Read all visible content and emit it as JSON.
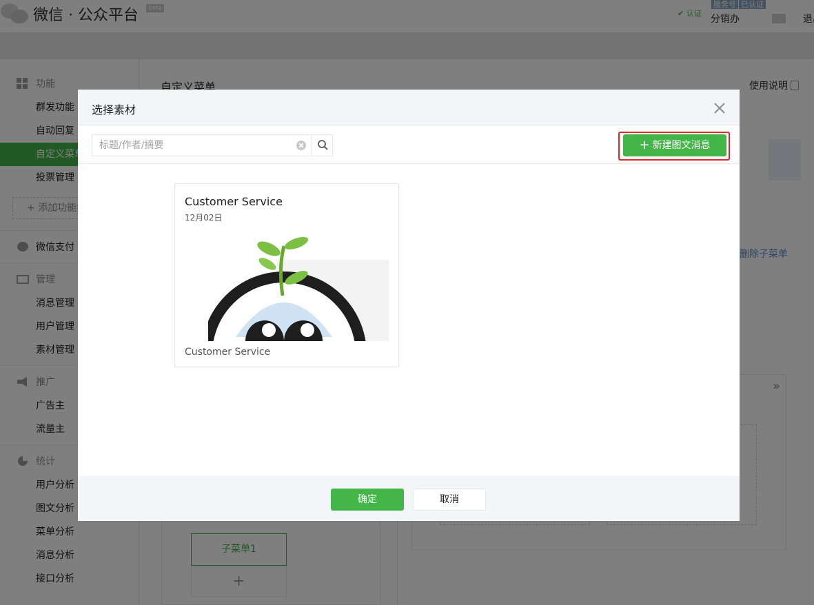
{
  "header": {
    "brand": "微信 · 公众平台",
    "beta_badge": "beta",
    "verified_badge": "✔ 认证",
    "account_type_tag": "服务号",
    "certified_tag": "已认证",
    "account_name": "分销办",
    "logout": "退出"
  },
  "sidebar": {
    "groups": [
      {
        "label": "功能",
        "icon": "grid-icon",
        "items": [
          "群发功能",
          "自动回复",
          "自定义菜单",
          "投票管理"
        ]
      },
      {
        "label": "微信支付",
        "icon": "wechat-pay-icon",
        "items": []
      },
      {
        "label": "管理",
        "icon": "inbox-icon",
        "items": [
          "消息管理",
          "用户管理",
          "素材管理"
        ]
      },
      {
        "label": "推广",
        "icon": "megaphone-icon",
        "items": [
          "广告主",
          "流量主"
        ]
      },
      {
        "label": "统计",
        "icon": "pie-chart-icon",
        "items": [
          "用户分析",
          "图文分析",
          "菜单分析",
          "消息分析",
          "接口分析"
        ]
      }
    ],
    "active_item": "自定义菜单",
    "add_function": "添加功能插件"
  },
  "page": {
    "title": "自定义菜单",
    "usage_link": "使用说明",
    "delete_submenu": "删除子菜单",
    "submenu_label": "子菜单1",
    "add_symbol": "+"
  },
  "dialog": {
    "title": "选择素材",
    "close_icon": "close-icon",
    "search": {
      "placeholder": "标题/作者/摘要",
      "value": ""
    },
    "new_button": "新建图文消息",
    "material": {
      "title": "Customer Service",
      "date": "12月02日",
      "digest": "Customer Service"
    },
    "ok": "确定",
    "cancel": "取消"
  },
  "colors": {
    "accent_green": "#44b549",
    "highlight_red": "#e02a2a",
    "dialog_header_bg": "#f4f5f9",
    "overlay": "rgba(0,0,0,0.5)"
  }
}
